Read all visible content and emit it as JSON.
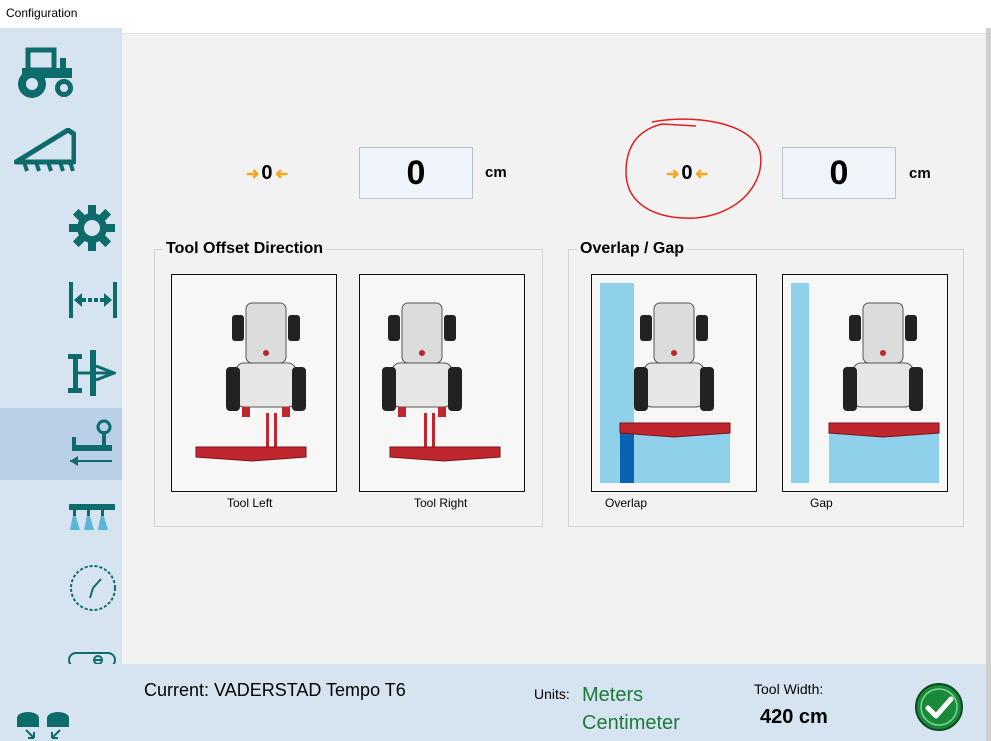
{
  "window": {
    "title": "Configuration"
  },
  "sidebar": {
    "items": [
      {
        "icon": "tractor-icon"
      },
      {
        "icon": "implement-icon"
      },
      {
        "icon": "gear-icon"
      },
      {
        "icon": "width-icon"
      },
      {
        "icon": "hitch-icon"
      },
      {
        "icon": "tool-offset-icon",
        "active": true
      },
      {
        "icon": "sections-icon"
      },
      {
        "icon": "clock-icon"
      },
      {
        "icon": "switch-icon"
      }
    ]
  },
  "offset_left": {
    "icon_text": "0",
    "value": "0",
    "unit": "cm"
  },
  "offset_right": {
    "icon_text": "0",
    "value": "0",
    "unit": "cm"
  },
  "tool_offset": {
    "title": "Tool Offset Direction",
    "options": [
      "Tool Left",
      "Tool Right"
    ]
  },
  "overlap_gap": {
    "title": "Overlap / Gap",
    "options": [
      "Overlap",
      "Gap"
    ]
  },
  "footer": {
    "current": "Current: VADERSTAD Tempo T6",
    "units_label": "Units:",
    "unit_meters": "Meters",
    "unit_centimeter": "Centimeter",
    "tool_width_label": "Tool Width:",
    "tool_width_value": "420 cm"
  },
  "colors": {
    "accent_teal": "#0e6b6b",
    "units_green": "#1f7a3a",
    "tool_red": "#c0262e",
    "field_blue": "#8fd0ea",
    "overlap_blue": "#0a62b0",
    "ok_green": "#1a8a3a"
  }
}
